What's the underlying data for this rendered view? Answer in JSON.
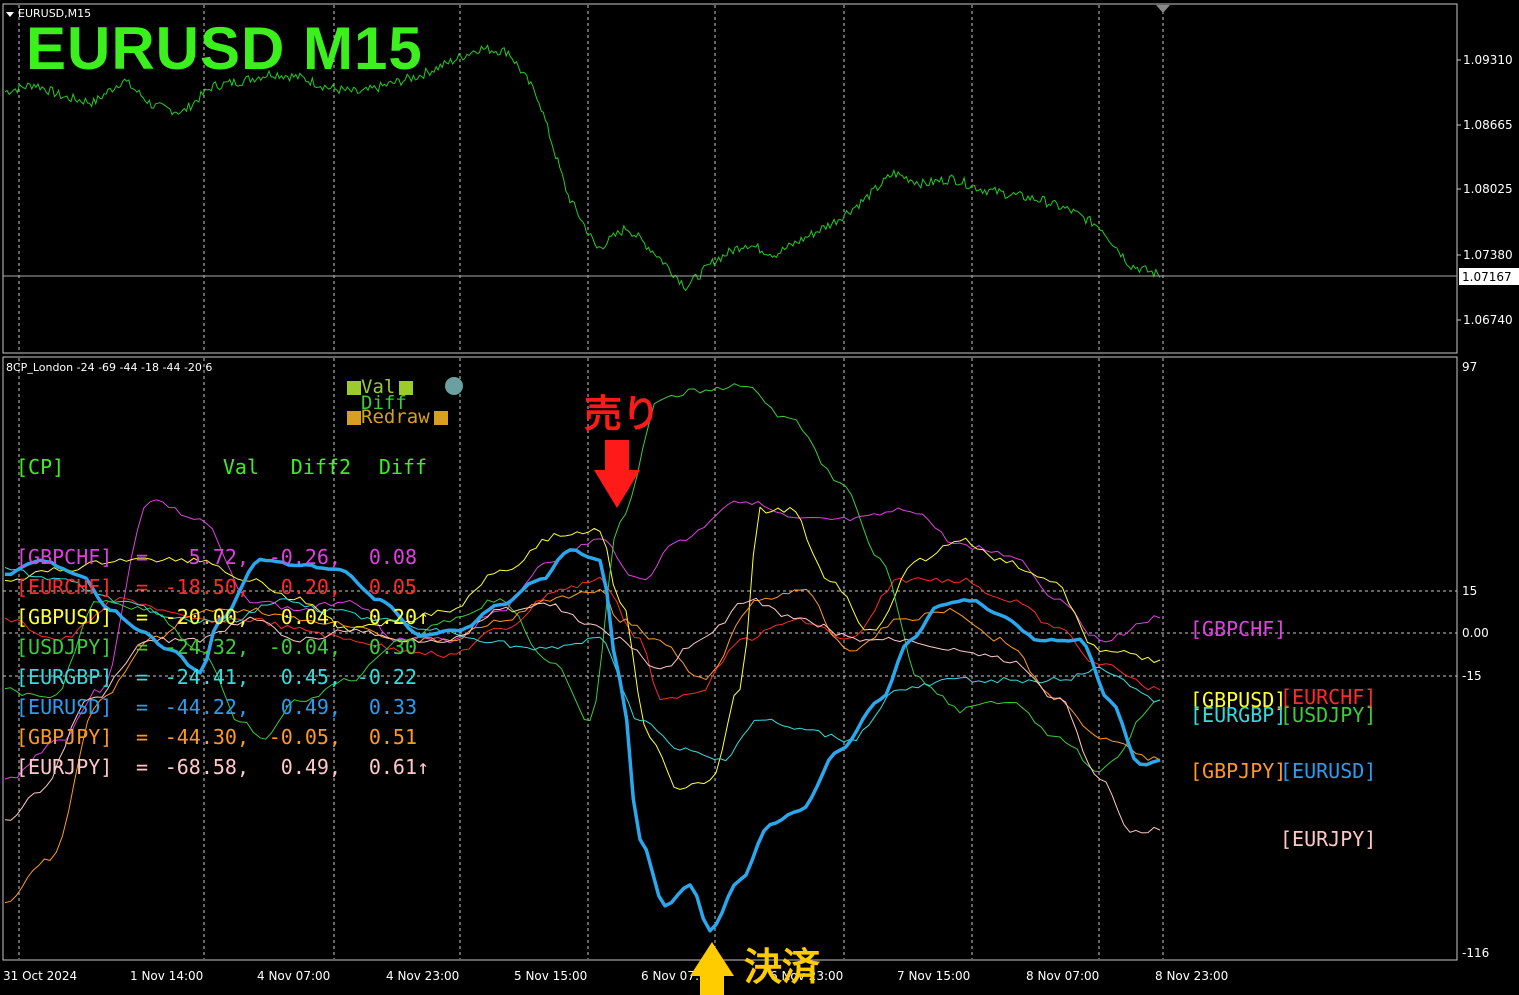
{
  "window": {
    "symbol_label": "EURUSD,M15",
    "big_title": "EURUSD  M15"
  },
  "price_axis": {
    "ticks": [
      "1.09310",
      "1.08665",
      "1.08025",
      "1.07380",
      "1.06740"
    ],
    "current": "1.07167"
  },
  "indicator": {
    "label": "8CP_London -24 -69 -44 -18 -44 -20 6",
    "axis_ticks": [
      "97",
      "15",
      "0.00",
      "-15",
      "-116"
    ],
    "legend": {
      "val": "Val",
      "diff": "Diff",
      "redraw": "Redraw"
    },
    "header": [
      "[CP]",
      "Val",
      "Diff2",
      "Diff"
    ],
    "rows": [
      {
        "pair": "[GBPCHF]",
        "eq": "=",
        "val": "5.72,",
        "diff2": "-0.26,",
        "diff": "0.08",
        "arrow": "",
        "color": "#e040e0"
      },
      {
        "pair": "[EURCHF]",
        "eq": "=",
        "val": "-18.50,",
        "diff2": "0.20,",
        "diff": "0.05",
        "arrow": "",
        "color": "#ff2a2a"
      },
      {
        "pair": "[GBPUSD]",
        "eq": "=",
        "val": "-20.00,",
        "diff2": "0.04,",
        "diff": "0.20",
        "arrow": "↑",
        "color": "#ffff33"
      },
      {
        "pair": "[USDJPY]",
        "eq": "=",
        "val": "-24.32,",
        "diff2": "-0.04,",
        "diff": "0.30",
        "arrow": "",
        "color": "#3ccc3c"
      },
      {
        "pair": "[EURGBP]",
        "eq": "=",
        "val": "-24.41,",
        "diff2": "0.45,",
        "diff": "-0.22",
        "arrow": "",
        "color": "#33dddd"
      },
      {
        "pair": "[EURUSD]",
        "eq": "=",
        "val": "-44.22,",
        "diff2": "0.49,",
        "diff": "0.33",
        "arrow": "",
        "color": "#2a9df0"
      },
      {
        "pair": "[GBPJPY]",
        "eq": "=",
        "val": "-44.30,",
        "diff2": "-0.05,",
        "diff": "0.51",
        "arrow": "",
        "color": "#ff9922"
      },
      {
        "pair": "[EURJPY]",
        "eq": "=",
        "val": "-68.58,",
        "diff2": "0.49,",
        "diff": "0.61",
        "arrow": "↑",
        "color": "#ffc8c8"
      }
    ],
    "right_labels": {
      "gbpchf": "[GBPCHF]",
      "gbpusd": "[GBPUSD]",
      "eurchf": "[EURCHF]",
      "eurgbp": "[EURGBP]",
      "usdjpy": "[USDJPY]",
      "gbpjpy": "[GBPJPY]",
      "eurusd": "[EURUSD]",
      "eurjpy": "[EURJPY]"
    }
  },
  "time_axis": [
    "31 Oct 2024",
    "1 Nov 14:00",
    "4 Nov 07:00",
    "4 Nov 23:00",
    "5 Nov 15:00",
    "6 Nov 07:00",
    "6 Nov 23:00",
    "7 Nov 15:00",
    "8 Nov 07:00",
    "8 Nov 23:00"
  ],
  "annotations": {
    "sell": "売り",
    "settle": "決済"
  },
  "colors": {
    "price_line": "#22cc22",
    "grid": "#c8c8c8",
    "sell": "#ff1a1a",
    "settle": "#ffcc00"
  },
  "chart_data": {
    "type": "line",
    "title": "EURUSD  M15",
    "ylabel": "",
    "price_series": {
      "name": "EURUSD",
      "y": [
        1.0885,
        1.0892,
        1.088,
        1.0875,
        1.0896,
        1.0872,
        1.0866,
        1.089,
        1.0895,
        1.0902,
        1.0898,
        1.0888,
        1.0884,
        1.0892,
        1.09,
        1.0912,
        1.0925,
        1.0922,
        1.088,
        1.079,
        1.074,
        1.076,
        1.0735,
        1.0705,
        1.073,
        1.0745,
        1.0735,
        1.075,
        1.0765,
        1.0785,
        1.081,
        1.08,
        1.0805,
        1.0795,
        1.079,
        1.0785,
        1.0775,
        1.076,
        1.0725,
        1.0716
      ]
    },
    "ylim_price": [
      1.0645,
      1.0965
    ],
    "oscillator_ylim": [
      -116,
      97
    ]
  }
}
